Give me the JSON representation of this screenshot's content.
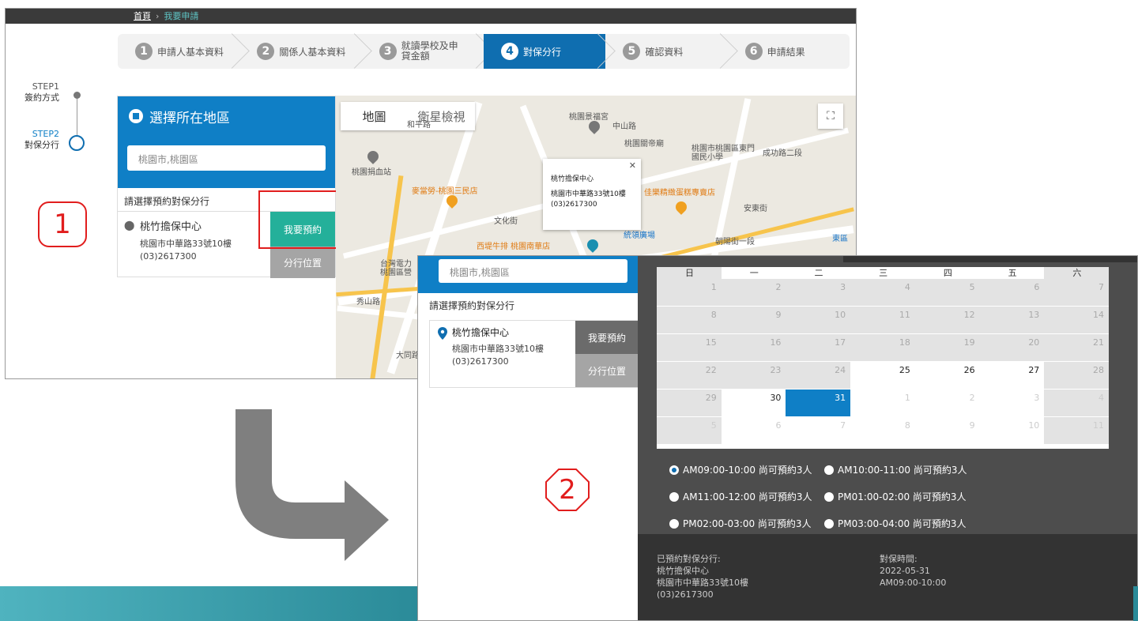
{
  "breadcrumb": {
    "home": "首頁",
    "current": "我要申請"
  },
  "steps": [
    {
      "num": "1",
      "label": "申請人基本資料"
    },
    {
      "num": "2",
      "label": "關係人基本資料"
    },
    {
      "num": "3",
      "label": "就讀學校及申貸金額"
    },
    {
      "num": "4",
      "label": "對保分行"
    },
    {
      "num": "5",
      "label": "確認資料"
    },
    {
      "num": "6",
      "label": "申請結果"
    }
  ],
  "side_steps": {
    "s1_title": "STEP1",
    "s1_label": "簽約方式",
    "s2_title": "STEP2",
    "s2_label": "對保分行"
  },
  "region_panel": {
    "title": "選擇所在地區",
    "region_value": "桃園市,桃園區",
    "subhead": "請選擇預約對保分行",
    "branch_name": "桃竹擔保中心",
    "branch_addr": "桃園市中華路33號10樓",
    "branch_phone": "(03)2617300",
    "book_label": "我要預約",
    "loc_label": "分行位置"
  },
  "map": {
    "tab_map": "地圖",
    "tab_sat": "衛星檢視",
    "popup_name": "桃竹擔保中心",
    "popup_addr": "桃園市中華路33號10樓",
    "popup_phone": "(03)2617300",
    "labels": [
      "桃園景福宮",
      "中山路",
      "桃園關帝廟",
      "桃園市桃園區東門國民小學",
      "桃園捐血站",
      "麥當勞-桃園三民店",
      "佳樂精緻蛋糕專賣店",
      "統領廣場",
      "西堤牛排 桃園南華店",
      "台灣電力桃園區營",
      "大同路",
      "東區",
      "和平路",
      "文化街",
      "安東街",
      "成功路二段",
      "朝陽街一段",
      "秀山路"
    ]
  },
  "annotations": {
    "marker1": "1",
    "marker2": "2"
  },
  "calendar": {
    "weekdays": [
      "日",
      "一",
      "二",
      "三",
      "四",
      "五",
      "六"
    ],
    "weeks": [
      [
        "1",
        "2",
        "3",
        "4",
        "5",
        "6",
        "7"
      ],
      [
        "8",
        "9",
        "10",
        "11",
        "12",
        "13",
        "14"
      ],
      [
        "15",
        "16",
        "17",
        "18",
        "19",
        "20",
        "21"
      ],
      [
        "22",
        "23",
        "24",
        "25",
        "26",
        "27",
        "28"
      ],
      [
        "29",
        "30",
        "31",
        "1",
        "2",
        "3",
        "4"
      ],
      [
        "5",
        "6",
        "7",
        "8",
        "9",
        "10",
        "11"
      ]
    ],
    "selected": "31"
  },
  "time_slots": [
    {
      "label": "AM09:00-10:00 尚可預約3人",
      "selected": true
    },
    {
      "label": "AM10:00-11:00 尚可預約3人",
      "selected": false
    },
    {
      "label": "AM11:00-12:00 尚可預約3人",
      "selected": false
    },
    {
      "label": "PM01:00-02:00 尚可預約3人",
      "selected": false
    },
    {
      "label": "PM02:00-03:00 尚可預約3人",
      "selected": false
    },
    {
      "label": "PM03:00-04:00 尚可預約3人",
      "selected": false
    }
  ],
  "summary": {
    "branch_title": "已預約對保分行:",
    "branch_name": "桃竹擔保中心",
    "branch_addr": "桃園市中華路33號10樓",
    "branch_phone": "(03)2617300",
    "time_title": "對保時間:",
    "date": "2022-05-31",
    "time": "AM09:00-10:00"
  },
  "colors": {
    "primary_blue": "#0f7fc6",
    "teal_button": "#24b09a",
    "annotation_red": "#e11d1d",
    "dark_panel": "#4d4d4d"
  }
}
